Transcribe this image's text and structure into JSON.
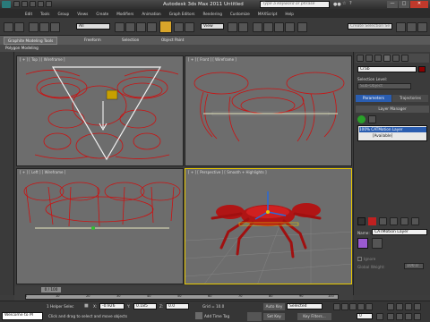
{
  "app": {
    "title": "Autodesk 3ds Max  2011",
    "document": "Untitled",
    "search_placeholder": "Type a keyword or phrase"
  },
  "menu": [
    "Edit",
    "Tools",
    "Group",
    "Views",
    "Create",
    "Modifiers",
    "Animation",
    "Graph Editors",
    "Rendering",
    "Customize",
    "MAXScript",
    "Help"
  ],
  "toolbar": {
    "selection_filter": "All",
    "ref_coord": "View",
    "named_selection": "Create Selection Se"
  },
  "ribbon": {
    "tabs": [
      "Graphite Modeling Tools",
      "Freeform",
      "Selection",
      "Object Paint"
    ],
    "panel": "Polygon Modeling"
  },
  "viewports": {
    "top": "[ + ] [ Top ] [ Wireframe ]",
    "front": "[ + ] [ Front ] [ Wireframe ]",
    "left": "[ + ] [ Left ] [ Wireframe ]",
    "perspective": "[ + ] [ Perspective ] [ Smooth + Highlights ]"
  },
  "cmd": {
    "object_name": "Crab",
    "selection_level": "Selection Level:",
    "sub_object": "Sub-Object",
    "tabs": [
      "Parameters",
      "Trajectories"
    ],
    "layer_manager": "Layer Manager",
    "layers": [
      "100% CATMotion Layer",
      "[Available]"
    ],
    "name_label": "Name:",
    "layer_name": "CATMotion Layer",
    "ignore": "Ignore",
    "global_weight": "Global Weight:",
    "weight_value": "100.0"
  },
  "timeline": {
    "slider": "0 / 100",
    "ticks": [
      "0",
      "10",
      "20",
      "30",
      "40",
      "50",
      "60",
      "70",
      "80",
      "90",
      "100"
    ]
  },
  "status": {
    "welcome": "Welcome to M",
    "helper": "1 Helper Selec",
    "x_label": "X:",
    "x": "-0.926",
    "y_label": "Y:",
    "y": "0.185",
    "z_label": "Z:",
    "z": "0.0",
    "grid": "Grid = 10.0",
    "prompt": "Click and drag to select and move objects",
    "add_time_tag": "Add Time Tag",
    "auto_key": "Auto Key",
    "auto_key_val": "Selected",
    "set_key": "Set Key",
    "key_filters": "Key Filters...",
    "frame": "0"
  },
  "colors": {
    "wire": "#cc1111",
    "crab": "#b01515",
    "viewport": "#6d6d6d",
    "highlight": "#e8c800"
  }
}
